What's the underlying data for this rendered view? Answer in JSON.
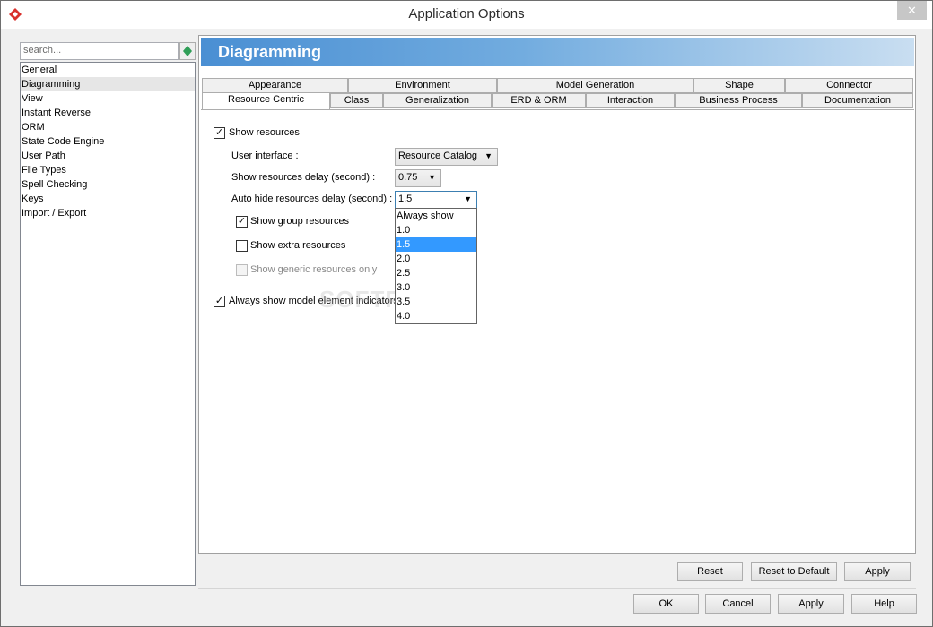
{
  "window": {
    "title": "Application Options",
    "close_glyph": "✕"
  },
  "search": {
    "placeholder": "search..."
  },
  "sidebar": {
    "items": [
      {
        "label": "General"
      },
      {
        "label": "Diagramming"
      },
      {
        "label": "View"
      },
      {
        "label": "Instant Reverse"
      },
      {
        "label": "ORM"
      },
      {
        "label": "State Code Engine"
      },
      {
        "label": "User Path"
      },
      {
        "label": "File Types"
      },
      {
        "label": "Spell Checking"
      },
      {
        "label": "Keys"
      },
      {
        "label": "Import / Export"
      }
    ],
    "selected": "Diagramming"
  },
  "header": {
    "title": "Diagramming"
  },
  "tabs": {
    "row1": [
      "Appearance",
      "Environment",
      "Model Generation",
      "Shape",
      "Connector"
    ],
    "row2": [
      "Resource Centric",
      "Class",
      "Generalization",
      "ERD & ORM",
      "Interaction",
      "Business Process",
      "Documentation"
    ],
    "active": "Resource Centric"
  },
  "form": {
    "show_resources": {
      "label": "Show resources",
      "checked": true
    },
    "user_interface": {
      "label": "User interface :",
      "value": "Resource Catalog"
    },
    "show_delay": {
      "label": "Show resources delay (second) :",
      "value": "0.75"
    },
    "auto_hide": {
      "label": "Auto hide resources delay (second) :",
      "value": "1.5",
      "options": [
        "Always show",
        "1.0",
        "1.5",
        "2.0",
        "2.5",
        "3.0",
        "3.5",
        "4.0"
      ],
      "selected_index": 2
    },
    "show_group": {
      "label": "Show group resources",
      "checked": true
    },
    "show_extra": {
      "label": "Show extra resources",
      "checked": false
    },
    "show_generic": {
      "label": "Show generic resources only",
      "checked": false,
      "disabled": true
    },
    "always_show_indicators": {
      "label": "Always show model element indicators",
      "checked": true
    }
  },
  "watermark": "SOFTPEDIA",
  "panel_buttons": {
    "reset": "Reset",
    "reset_default": "Reset to Default",
    "apply": "Apply"
  },
  "dialog_buttons": {
    "ok": "OK",
    "cancel": "Cancel",
    "apply": "Apply",
    "help": "Help"
  },
  "colors": {
    "accent": "#3399ff",
    "banner": "#4a8fd3"
  }
}
